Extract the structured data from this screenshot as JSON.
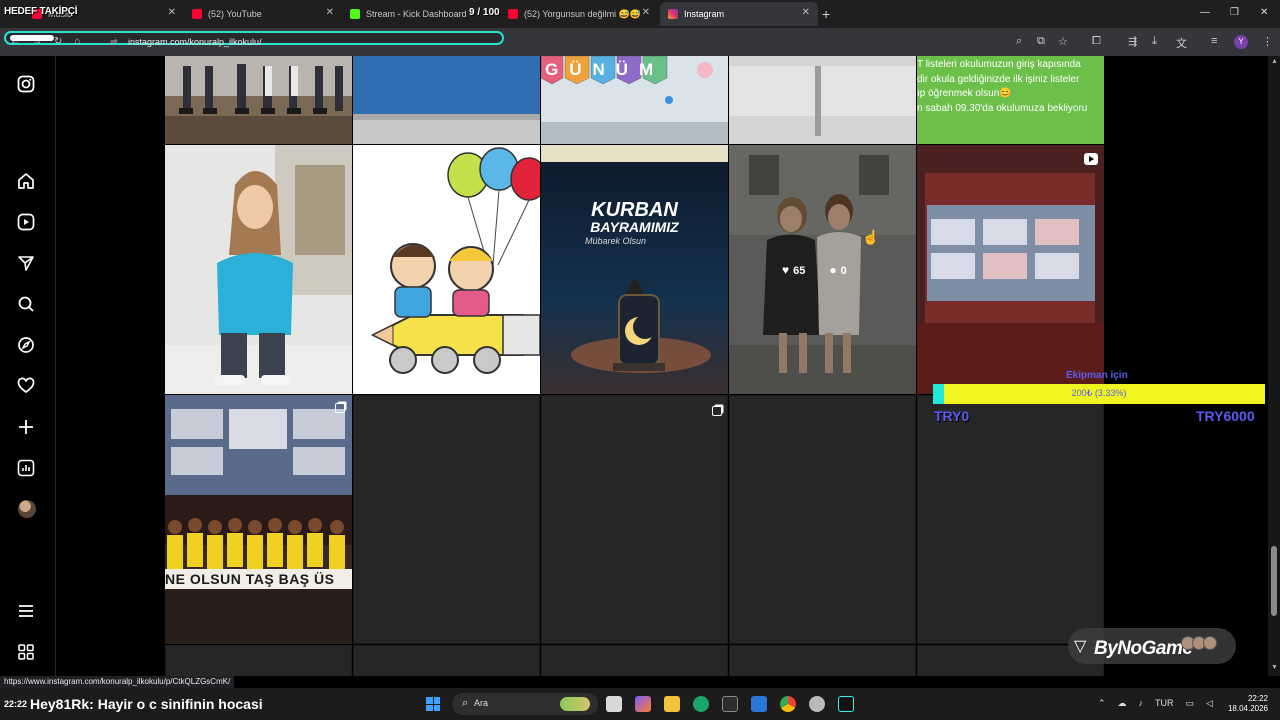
{
  "overlay": {
    "brand": "HEDEF TAKİPÇİ",
    "count": "9 / 100"
  },
  "tabs": [
    {
      "title": "Music",
      "color": "#ff0033"
    },
    {
      "title": "(52) YouTube",
      "color": "#ff0033"
    },
    {
      "title": "Stream - Kick Dashboard",
      "color": "#53fc18"
    },
    {
      "title": "(52) Yorgunsun değilmi 😅😅",
      "color": "#ff0033"
    },
    {
      "title": "Instagram",
      "color": "#e1306c"
    }
  ],
  "address_bar": {
    "url": "instagram.com/konuralp_ilkokulu/"
  },
  "posts": {
    "post1_lines": [
      "T listeleri okulumuzun giriş kapısında",
      "dir okula geldiğinizde ilk işiniz listeler",
      "ıp öğrenmek  olsun😊",
      "n sabah 09.30'da okulumuza bekliyoru"
    ],
    "banner_letters": "GÜNÜM",
    "kurban_title_1": "KURBAN",
    "kurban_title_2": "BAYRAMIMIZ",
    "kurban_sub": "Mübarek Olsun",
    "banner_text": "NE OLSUN TAŞ BAŞ ÜS"
  },
  "hover": {
    "likes": "65",
    "comments": "0"
  },
  "donation": {
    "title": "Ekipman için",
    "progress_text": "200₺ (3.33%)",
    "progress": 0.0333,
    "min": "TRY0",
    "max": "TRY6000"
  },
  "bynogame": {
    "label": "ByNoGame"
  },
  "status_url": "https://www.instagram.com/konuralp_ilkokulu/p/CtkQLZGsCmK/",
  "taskbar": {
    "chat_time": "22:22",
    "chat_user": "Hey81Rk",
    "chat_message": ": Hayir o c sinifinin hocasi",
    "search_placeholder": "Ara",
    "language": "TUR",
    "time": "22:22",
    "date": "18.04.2026"
  },
  "colors": {
    "accent_cyan": "#2ce0d0",
    "donation_yellow": "#f0f520",
    "donation_text": "#5a5af0"
  },
  "icons": {
    "sidebar": [
      "instagram-logo-icon",
      "home-icon",
      "reels-icon",
      "direct-icon",
      "search-icon",
      "explore-icon",
      "heart-icon",
      "create-icon",
      "dashboard-icon",
      "profile-avatar",
      "menu-icon",
      "threads-icon"
    ]
  }
}
